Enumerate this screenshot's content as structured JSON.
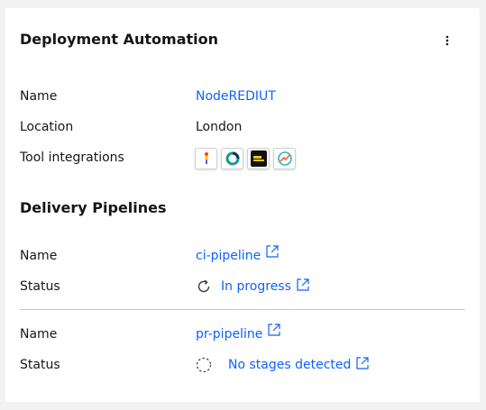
{
  "card": {
    "title": "Deployment Automation",
    "overflow_icon": "overflow-menu-vertical-icon"
  },
  "details": {
    "name_label": "Name",
    "name_value": "NodeREDIUT",
    "location_label": "Location",
    "location_value": "London",
    "tools_label": "Tool integrations",
    "tools": [
      {
        "icon": "lightbulb-tool-icon"
      },
      {
        "icon": "ring-tool-icon"
      },
      {
        "icon": "dark-tool-icon"
      },
      {
        "icon": "gauge-tool-icon"
      }
    ]
  },
  "pipelines": {
    "section_title": "Delivery Pipelines",
    "items": [
      {
        "name_label": "Name",
        "name": "ci-pipeline",
        "status_label": "Status",
        "status": "In progress",
        "status_icon": "in-progress-icon"
      },
      {
        "name_label": "Name",
        "name": "pr-pipeline",
        "status_label": "Status",
        "status": "No stages detected",
        "status_icon": "not-started-icon"
      }
    ]
  },
  "colors": {
    "link": "#0f62fe",
    "text": "#161616",
    "background": "#f2f2f2",
    "card": "#ffffff",
    "divider": "#c6c6c6"
  }
}
